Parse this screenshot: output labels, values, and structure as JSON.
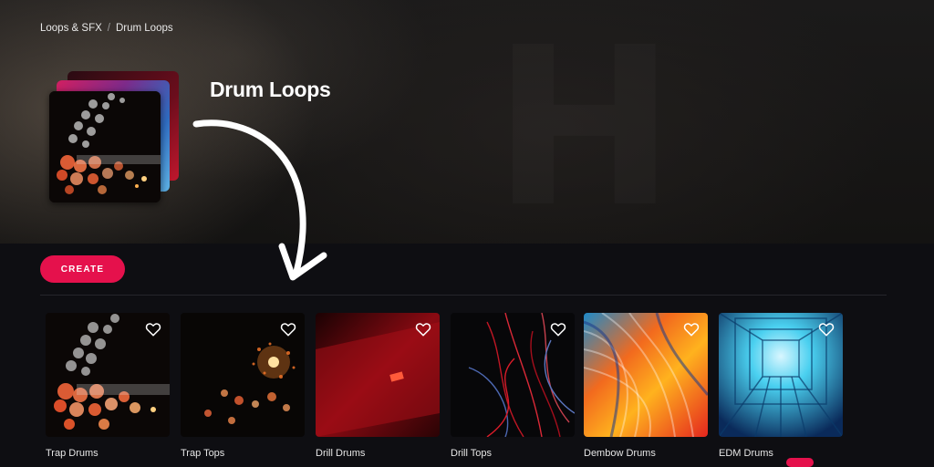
{
  "breadcrumb": {
    "items": [
      "Loops & SFX",
      "Drum Loops"
    ],
    "separator": "/"
  },
  "page": {
    "title": "Drum Loops"
  },
  "actions": {
    "create_label": "CREATE"
  },
  "colors": {
    "accent": "#e5114c",
    "background": "#0e0e12"
  },
  "packs": [
    {
      "label": "Trap Drums",
      "favorite_icon": "heart-outline-icon"
    },
    {
      "label": "Trap Tops",
      "favorite_icon": "heart-outline-icon"
    },
    {
      "label": "Drill Drums",
      "favorite_icon": "heart-outline-icon"
    },
    {
      "label": "Drill Tops",
      "favorite_icon": "heart-outline-icon"
    },
    {
      "label": "Dembow Drums",
      "favorite_icon": "heart-outline-icon"
    },
    {
      "label": "EDM Drums",
      "favorite_icon": "heart-outline-icon"
    }
  ]
}
